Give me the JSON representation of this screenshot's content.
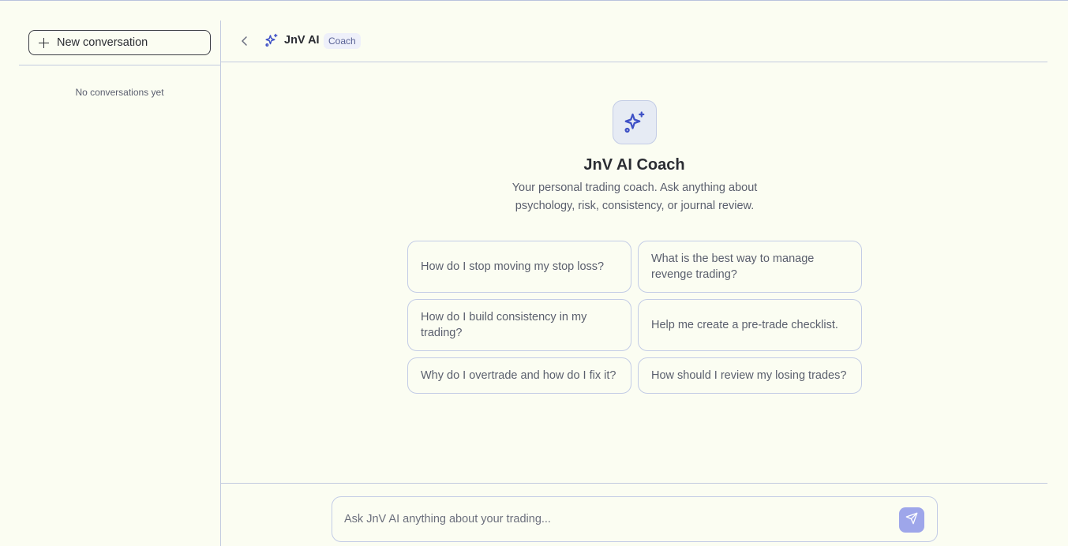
{
  "sidebar": {
    "new_conversation_label": "New conversation",
    "empty_state": "No conversations yet"
  },
  "header": {
    "title": "JnV AI",
    "badge": "Coach",
    "icons": {
      "back": "chevron-left-icon",
      "brand": "sparkles-icon"
    }
  },
  "hero": {
    "title": "JnV AI Coach",
    "subtitle": "Your personal trading coach. Ask anything about psychology, risk, consistency, or journal review."
  },
  "suggestions": [
    "How do I stop moving my stop loss?",
    "What is the best way to manage revenge trading?",
    "How do I build consistency in my trading?",
    "Help me create a pre-trade checklist.",
    "Why do I overtrade and how do I fix it?",
    "How should I review my losing trades?"
  ],
  "composer": {
    "placeholder": "Ask JnV AI anything about your trading...",
    "send_icon": "send-icon"
  },
  "colors": {
    "background": "#fbfdf2",
    "accent": "#3f51c6",
    "send_button": "#9ea6ea",
    "border": "#c3cce6"
  }
}
